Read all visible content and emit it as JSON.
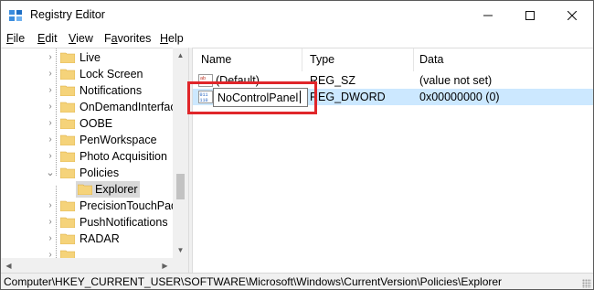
{
  "window": {
    "title": "Registry Editor"
  },
  "menu": {
    "items": [
      {
        "mnemonic": "F",
        "rest": "ile"
      },
      {
        "mnemonic": "E",
        "rest": "dit"
      },
      {
        "mnemonic": "V",
        "rest": "iew"
      },
      {
        "mnemonic": "",
        "pre": "F",
        "mid": "a",
        "post": "vorites"
      },
      {
        "mnemonic": "H",
        "rest": "elp"
      }
    ]
  },
  "tree": {
    "items": [
      {
        "label": "Live",
        "expandable": true
      },
      {
        "label": "Lock Screen",
        "expandable": true
      },
      {
        "label": "Notifications",
        "expandable": true
      },
      {
        "label": "OnDemandInterfac",
        "expandable": true
      },
      {
        "label": "OOBE",
        "expandable": true
      },
      {
        "label": "PenWorkspace",
        "expandable": true
      },
      {
        "label": "Photo Acquisition",
        "expandable": true
      },
      {
        "label": "Policies",
        "expanded": true
      },
      {
        "label": "Explorer",
        "selected": true
      },
      {
        "label": "PrecisionTouchPad",
        "expandable": true
      },
      {
        "label": "PushNotifications",
        "expandable": true
      },
      {
        "label": "RADAR",
        "expandable": true
      }
    ]
  },
  "list": {
    "columns": [
      "Name",
      "Type",
      "Data"
    ],
    "rows": [
      {
        "name": "(Default)",
        "type": "REG_SZ",
        "data": "(value not set)",
        "icon": "string-value-icon"
      },
      {
        "name": "NoControlPanel",
        "type": "REG_DWORD",
        "data": "0x00000000 (0)",
        "icon": "dword-value-icon",
        "editing": true
      }
    ],
    "rename_value": "NoControlPanel"
  },
  "status": {
    "path": "Computer\\HKEY_CURRENT_USER\\SOFTWARE\\Microsoft\\Windows\\CurrentVersion\\Policies\\Explorer"
  },
  "colors": {
    "highlight": "#e0262a",
    "selection": "#cce8ff",
    "folder": "#f5d37a"
  }
}
